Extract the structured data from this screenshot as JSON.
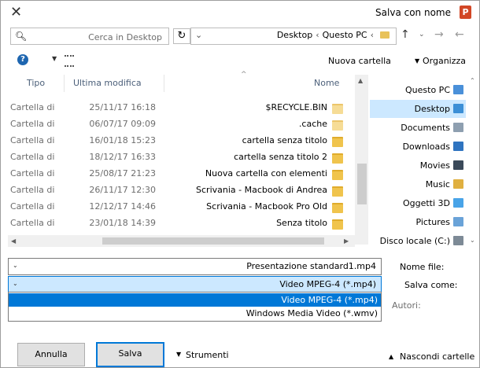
{
  "window": {
    "title": "Salva con nome",
    "app_icon_letter": "P"
  },
  "address": {
    "crumbs": [
      "Questo PC",
      "Desktop"
    ]
  },
  "search": {
    "placeholder": "Cerca in Desktop"
  },
  "toolbar": {
    "organize_label": "Organizza",
    "new_folder_label": "Nuova cartella"
  },
  "filelist": {
    "columns": {
      "name": "Nome",
      "modified": "Ultima modifica",
      "type": "Tipo"
    },
    "rows": [
      {
        "name": "$RECYCLE.BIN",
        "modified": "25/11/17 16:18",
        "type": "Cartella di",
        "pale": true
      },
      {
        "name": ".cache",
        "modified": "06/07/17 09:09",
        "type": "Cartella di",
        "pale": true
      },
      {
        "name": "cartella senza titolo",
        "modified": "16/01/18 15:23",
        "type": "Cartella di",
        "pale": false
      },
      {
        "name": "cartella senza titolo 2",
        "modified": "18/12/17 16:33",
        "type": "Cartella di",
        "pale": false
      },
      {
        "name": "Nuova cartella con elementi",
        "modified": "25/08/17 21:23",
        "type": "Cartella di",
        "pale": false
      },
      {
        "name": "Scrivania - Macbook di Andrea",
        "modified": "26/11/17 12:30",
        "type": "Cartella di",
        "pale": false
      },
      {
        "name": "Scrivania - Macbook Pro Old",
        "modified": "12/12/17 14:46",
        "type": "Cartella di",
        "pale": false
      },
      {
        "name": "Senza titolo",
        "modified": "23/01/18 14:39",
        "type": "Cartella di",
        "pale": false
      }
    ]
  },
  "sidebar": {
    "items": [
      {
        "label": "Questo PC",
        "icon": "computer-icon",
        "color": "#4a90d9",
        "selected": false
      },
      {
        "label": "Desktop",
        "icon": "desktop-icon",
        "color": "#3c8fd6",
        "selected": true
      },
      {
        "label": "Documents",
        "icon": "documents-icon",
        "color": "#8e9fb0",
        "selected": false
      },
      {
        "label": "Downloads",
        "icon": "downloads-icon",
        "color": "#2f74c0",
        "selected": false
      },
      {
        "label": "Movies",
        "icon": "movies-icon",
        "color": "#3b4a5a",
        "selected": false
      },
      {
        "label": "Music",
        "icon": "music-icon",
        "color": "#e0b040",
        "selected": false
      },
      {
        "label": "Oggetti 3D",
        "icon": "objects-3d-icon",
        "color": "#49a4e8",
        "selected": false
      },
      {
        "label": "Pictures",
        "icon": "pictures-icon",
        "color": "#6aa3d8",
        "selected": false
      },
      {
        "label": "Disco locale (C:)",
        "icon": "drive-icon",
        "color": "#7d8a96",
        "selected": false
      }
    ]
  },
  "form": {
    "filename_label": "Nome file:",
    "filename_value": "Presentazione standard1.mp4",
    "savetype_label": "Salva come:",
    "savetype_value": "Video MPEG-4 (*.mp4)",
    "savetype_options": [
      "Video MPEG-4 (*.mp4)",
      "Windows Media Video (*.wmv)"
    ],
    "authors_label": "Autori:"
  },
  "footer": {
    "hide_folders_label": "Nascondi cartelle",
    "tools_label": "Strumenti",
    "save_label": "Salva",
    "cancel_label": "Annulla"
  },
  "colors": {
    "accent": "#0078d7",
    "selection": "#cce8ff",
    "folder": "#f0c44d"
  }
}
